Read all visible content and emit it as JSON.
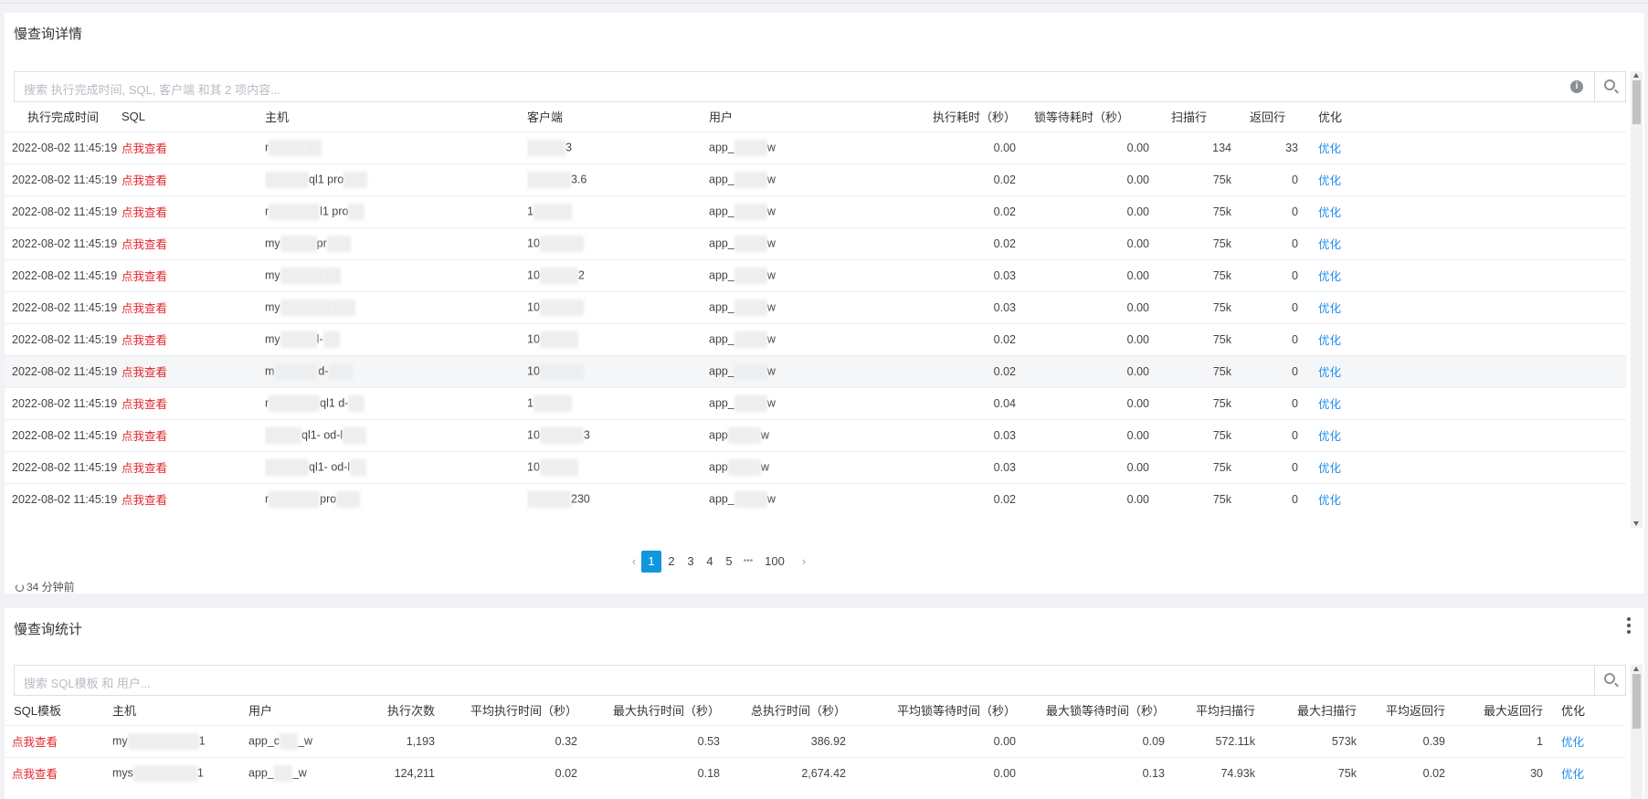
{
  "detail": {
    "title": "慢查询详情",
    "search_placeholder": "搜索 执行完成时间, SQL, 客户端 和其 2 项内容...",
    "info_icon_label": "i",
    "columns": [
      "执行完成时间",
      "SQL",
      "主机",
      "客户端",
      "用户",
      "执行耗时（秒）",
      "锁等待耗时（秒）",
      "扫描行",
      "返回行",
      "优化"
    ],
    "rows": [
      {
        "time": "2022-08-02 11:45:19",
        "sql": "点我查看",
        "host_pre": "r",
        "host_suf": "",
        "client_pre": "",
        "client_suf": "3",
        "user_pre": "app_",
        "user_suf": "w",
        "exec": "0.00",
        "lock": "0.00",
        "scan": "134",
        "ret": "33",
        "opt": "优化"
      },
      {
        "time": "2022-08-02 11:45:19",
        "sql": "点我查看",
        "host_pre": "",
        "host_suf": "ql1  pro",
        "client_pre": "",
        "client_suf": "3.6",
        "user_pre": "app_",
        "user_suf": "w",
        "exec": "0.02",
        "lock": "0.00",
        "scan": "75k",
        "ret": "0",
        "opt": "优化"
      },
      {
        "time": "2022-08-02 11:45:19",
        "sql": "点我查看",
        "host_pre": "r",
        "host_suf": "l1  pro",
        "client_pre": "1",
        "client_suf": "",
        "user_pre": "app_",
        "user_suf": "w",
        "exec": "0.02",
        "lock": "0.00",
        "scan": "75k",
        "ret": "0",
        "opt": "优化"
      },
      {
        "time": "2022-08-02 11:45:19",
        "sql": "点我查看",
        "host_pre": "my",
        "host_suf": "pr",
        "client_pre": "10",
        "client_suf": "",
        "user_pre": "app_",
        "user_suf": "w",
        "exec": "0.02",
        "lock": "0.00",
        "scan": "75k",
        "ret": "0",
        "opt": "优化"
      },
      {
        "time": "2022-08-02 11:45:19",
        "sql": "点我查看",
        "host_pre": "my",
        "host_suf": "",
        "client_pre": "10",
        "client_suf": "2",
        "user_pre": "app_",
        "user_suf": "w",
        "exec": "0.03",
        "lock": "0.00",
        "scan": "75k",
        "ret": "0",
        "opt": "优化"
      },
      {
        "time": "2022-08-02 11:45:19",
        "sql": "点我查看",
        "host_pre": "my",
        "host_suf": "",
        "client_pre": "10",
        "client_suf": "",
        "user_pre": "app_",
        "user_suf": "w",
        "exec": "0.03",
        "lock": "0.00",
        "scan": "75k",
        "ret": "0",
        "opt": "优化"
      },
      {
        "time": "2022-08-02 11:45:19",
        "sql": "点我查看",
        "host_pre": "my",
        "host_suf": "l-",
        "client_pre": "10",
        "client_suf": "",
        "user_pre": "app_",
        "user_suf": "w",
        "exec": "0.02",
        "lock": "0.00",
        "scan": "75k",
        "ret": "0",
        "opt": "优化"
      },
      {
        "time": "2022-08-02 11:45:19",
        "sql": "点我查看",
        "host_pre": "m",
        "host_suf": "d-",
        "client_pre": "10",
        "client_suf": "",
        "user_pre": "app_",
        "user_suf": "w",
        "exec": "0.02",
        "lock": "0.00",
        "scan": "75k",
        "ret": "0",
        "opt": "优化"
      },
      {
        "time": "2022-08-02 11:45:19",
        "sql": "点我查看",
        "host_pre": "r",
        "host_suf": "ql1  d-",
        "client_pre": "1",
        "client_suf": "",
        "user_pre": "app_",
        "user_suf": "w",
        "exec": "0.04",
        "lock": "0.00",
        "scan": "75k",
        "ret": "0",
        "opt": "优化"
      },
      {
        "time": "2022-08-02 11:45:19",
        "sql": "点我查看",
        "host_pre": "",
        "host_suf": "ql1-  od-l",
        "client_pre": "10",
        "client_suf": "3",
        "user_pre": "app",
        "user_suf": "w",
        "exec": "0.03",
        "lock": "0.00",
        "scan": "75k",
        "ret": "0",
        "opt": "优化"
      },
      {
        "time": "2022-08-02 11:45:19",
        "sql": "点我查看",
        "host_pre": "",
        "host_suf": "ql1-  od-l",
        "client_pre": "10",
        "client_suf": "",
        "user_pre": "app",
        "user_suf": "w",
        "exec": "0.03",
        "lock": "0.00",
        "scan": "75k",
        "ret": "0",
        "opt": "优化"
      },
      {
        "time": "2022-08-02 11:45:19",
        "sql": "点我查看",
        "host_pre": "r",
        "host_suf": "pro",
        "client_pre": "",
        "client_suf": "230",
        "user_pre": "app_",
        "user_suf": "w",
        "exec": "0.02",
        "lock": "0.00",
        "scan": "75k",
        "ret": "0",
        "opt": "优化"
      }
    ],
    "pagination": {
      "prev": "‹",
      "pages": [
        "1",
        "2",
        "3",
        "4",
        "5"
      ],
      "ellipsis": "•••",
      "last": "100",
      "next": "›",
      "current": "1"
    },
    "refresh_text": "34 分钟前"
  },
  "stats": {
    "title": "慢查询统计",
    "search_placeholder": "搜索 SQL模板 和 用户...",
    "columns": [
      "SQL模板",
      "主机",
      "用户",
      "执行次数",
      "平均执行时间（秒）",
      "最大执行时间（秒）",
      "总执行时间（秒）",
      "平均锁等待时间（秒）",
      "最大锁等待时间（秒）",
      "平均扫描行",
      "最大扫描行",
      "平均返回行",
      "最大返回行",
      "优化"
    ],
    "rows": [
      {
        "sql": "点我查看",
        "host_pre": "my",
        "host_suf": "1",
        "user_pre": "app_c",
        "user_suf": "_w",
        "count": "1,193",
        "avg": "0.32",
        "max": "0.53",
        "total": "386.92",
        "avg_lock": "0.00",
        "max_lock": "0.09",
        "avg_scan": "572.11k",
        "max_scan": "573k",
        "avg_ret": "0.39",
        "max_ret": "1",
        "opt": "优化"
      },
      {
        "sql": "点我查看",
        "host_pre": "mys",
        "host_suf": "1",
        "user_pre": "app_",
        "user_suf": "_w",
        "count": "124,211",
        "avg": "0.02",
        "max": "0.18",
        "total": "2,674.42",
        "avg_lock": "0.00",
        "max_lock": "0.13",
        "avg_scan": "74.93k",
        "max_scan": "75k",
        "avg_ret": "0.02",
        "max_ret": "30",
        "opt": "优化"
      }
    ]
  },
  "colors": {
    "accent": "#1296db",
    "link_red": "#e5252a",
    "link_blue": "#1f8ceb"
  }
}
